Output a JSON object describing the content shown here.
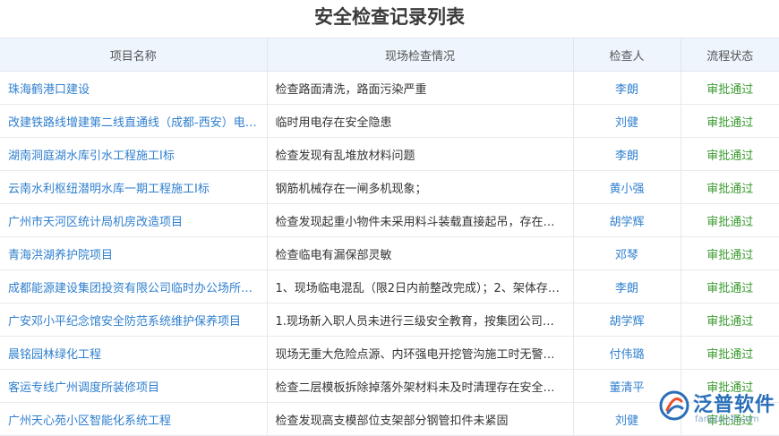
{
  "page_title": "安全检查记录列表",
  "columns": [
    "项目名称",
    "现场检查情况",
    "检查人",
    "流程状态"
  ],
  "rows": [
    {
      "project": "珠海鹤港口建设",
      "issue": "检查路面清洗，路面污染严重",
      "inspector": "李朗",
      "status": "审批通过"
    },
    {
      "project": "改建铁路线增建第二线直通线（成都-西安）电…",
      "issue": "临时用电存在安全隐患",
      "inspector": "刘健",
      "status": "审批通过"
    },
    {
      "project": "湖南洞庭湖水库引水工程施工I标",
      "issue": "检查发现有乱堆放材料问题",
      "inspector": "李朗",
      "status": "审批通过"
    },
    {
      "project": "云南水利枢纽潜明水库一期工程施工I标",
      "issue": "钢筋机械存在一闸多机现象；",
      "inspector": "黄小强",
      "status": "审批通过"
    },
    {
      "project": "广州市天河区统计局机房改造项目",
      "issue": "检查发现起重小物件未采用料斗装载直接起吊，存在…",
      "inspector": "胡学辉",
      "status": "审批通过"
    },
    {
      "project": "青海洪湖养护院项目",
      "issue": "检查临电有漏保部灵敏",
      "inspector": "邓琴",
      "status": "审批通过"
    },
    {
      "project": "成都能源建设集团投资有限公司临时办公场所…",
      "issue": "1、现场临电混乱（限2日内前整改完成）；2、架体存…",
      "inspector": "李朗",
      "status": "审批通过"
    },
    {
      "project": "广安邓小平纪念馆安全防范系统维护保养项目",
      "issue": "1.现场新入职人员未进行三级安全教育，按集团公司…",
      "inspector": "胡学辉",
      "status": "审批通过"
    },
    {
      "project": "晨铭园林绿化工程",
      "issue": "现场无重大危险点源、内环强电开挖管沟施工时无警…",
      "inspector": "付伟璐",
      "status": "审批通过"
    },
    {
      "project": "客运专线广州调度所装修项目",
      "issue": "检查二层模板拆除掉落外架材料未及时清理存在安全…",
      "inspector": "董清平",
      "status": "审批通过"
    },
    {
      "project": "广州天心苑小区智能化系统工程",
      "issue": "检查发现高支模部位支架部分钢管扣件未紧固",
      "inspector": "刘健",
      "status": "审批通过"
    }
  ],
  "watermark": {
    "brand": "泛普软件",
    "url": "fanpusoft.com",
    "logo_icon": "fanpu-logo-icon"
  }
}
